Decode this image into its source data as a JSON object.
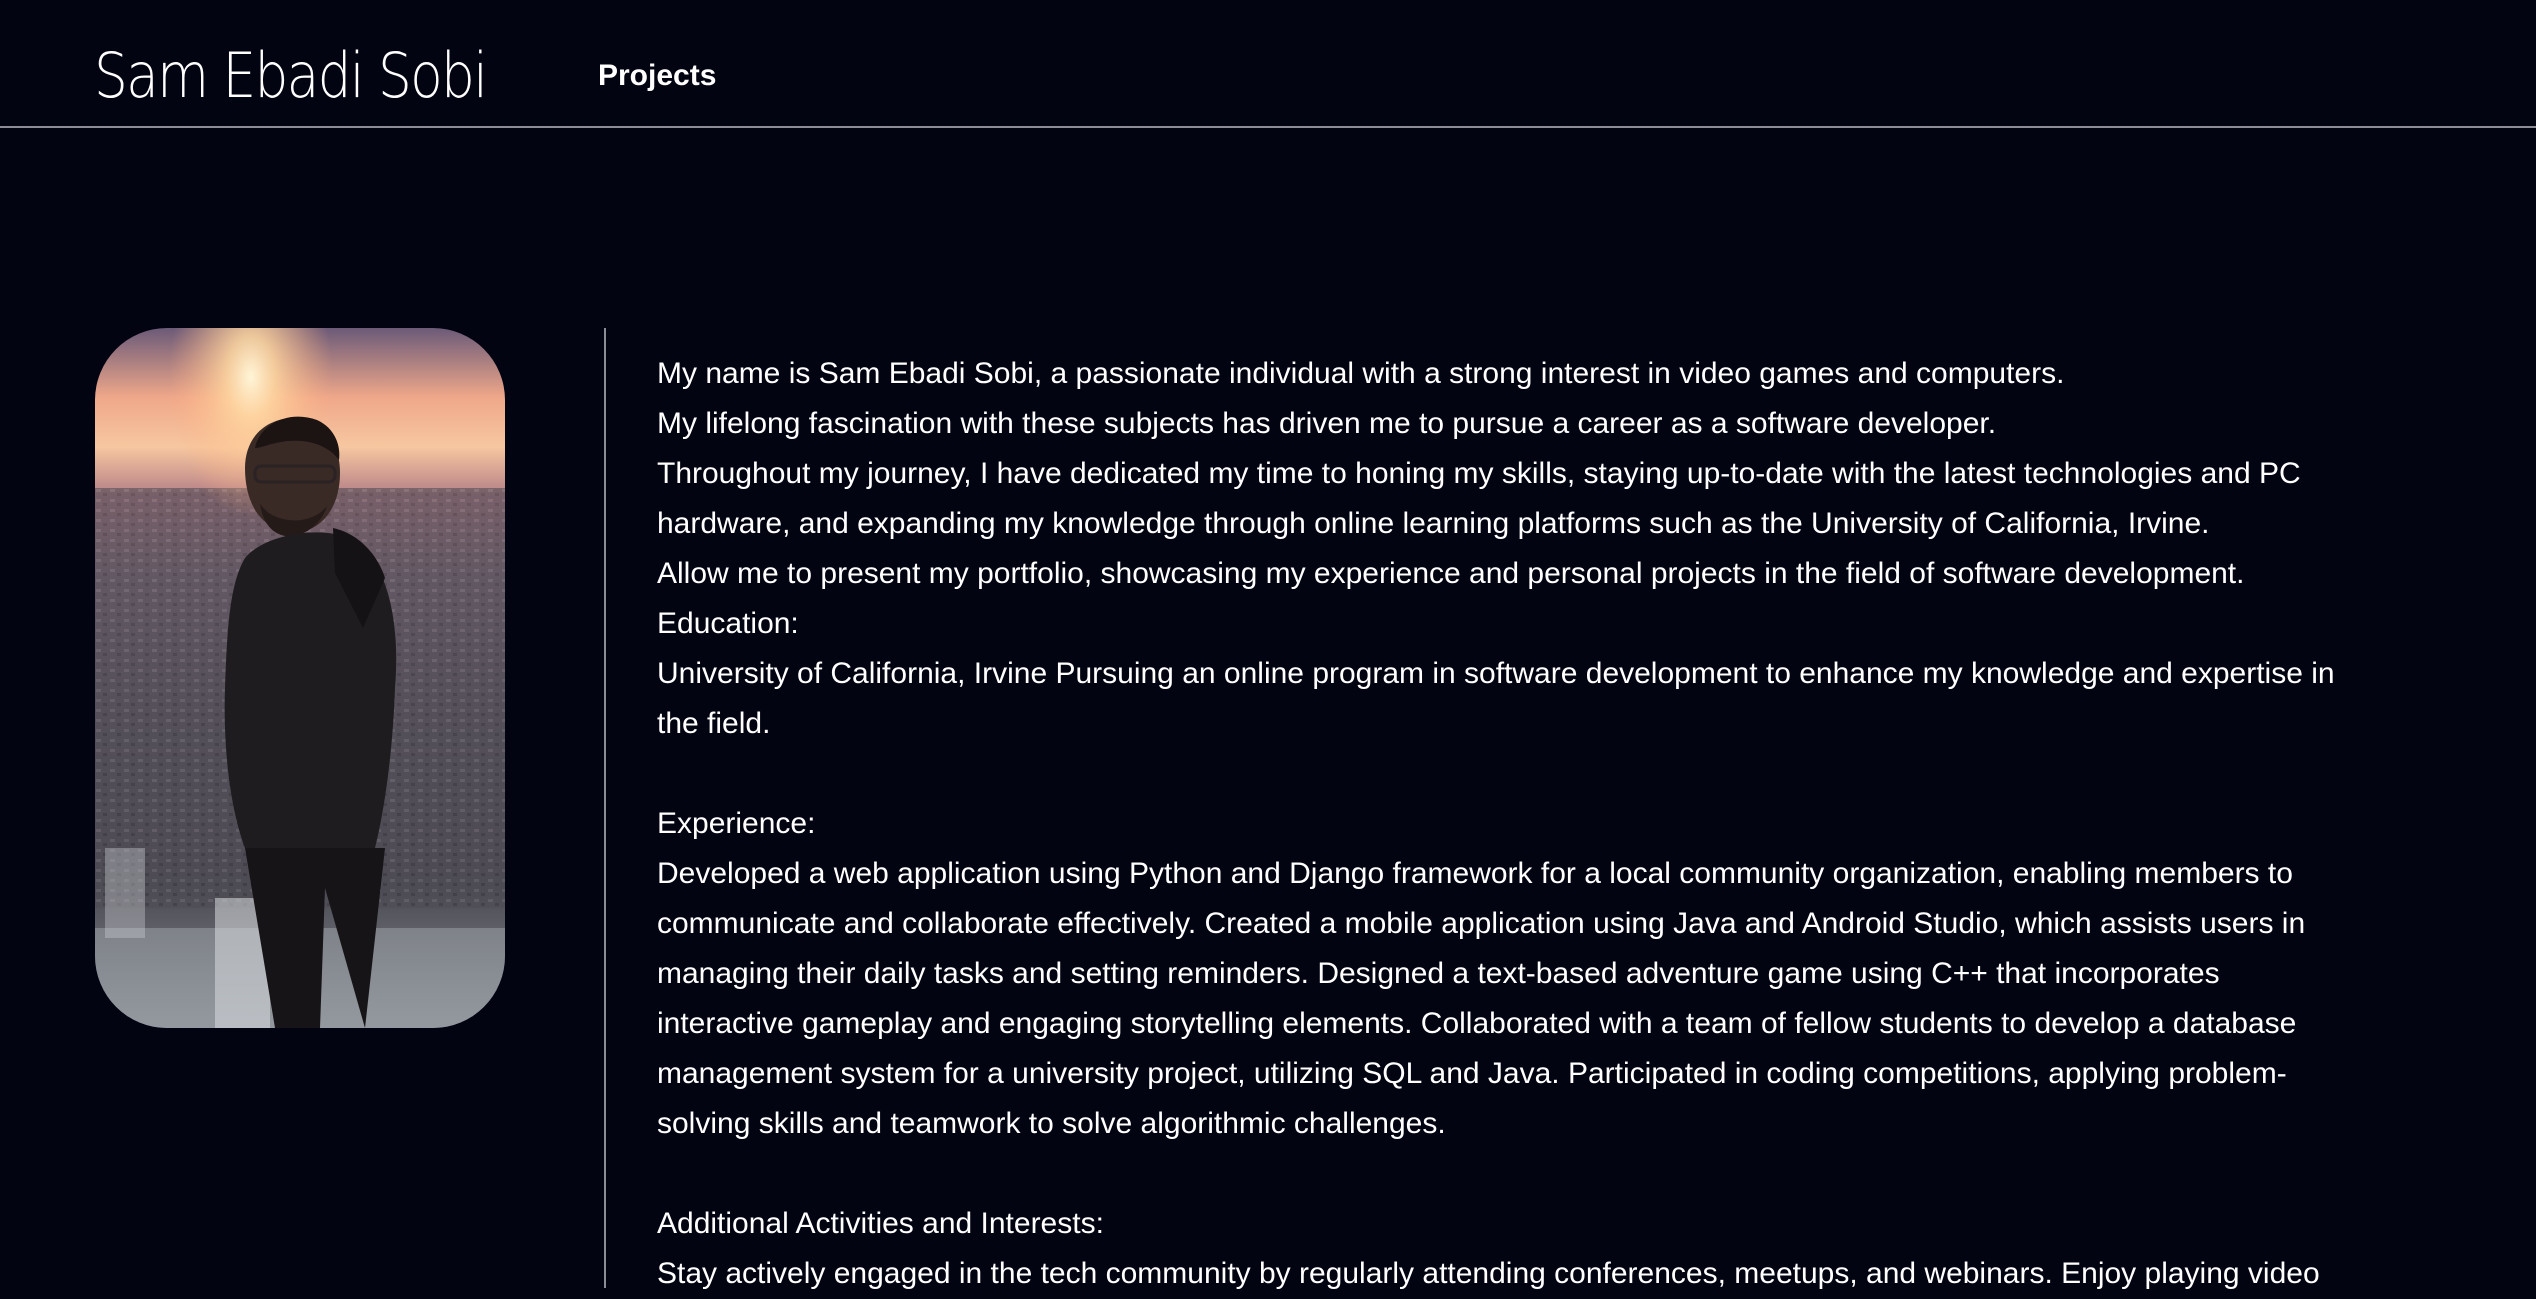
{
  "header": {
    "brand": "Sam Ebadi Sobi",
    "nav": [
      {
        "label": "Projects"
      }
    ]
  },
  "profile": {
    "photo_icon": "portrait-photo"
  },
  "about": {
    "intro": [
      "My name is Sam Ebadi Sobi, a passionate individual with a strong interest in video games and computers.",
      "My lifelong fascination with these subjects has driven me to pursue a career as a software developer.",
      "Throughout my journey, I have dedicated my time to honing my skills, staying up-to-date with the latest technologies and PC hardware, and expanding my knowledge through online learning platforms such as the University of California, Irvine.",
      "Allow me to present my portfolio, showcasing my experience and personal projects in the field of software development."
    ],
    "education_heading": "Education:",
    "education_text": "University of California, Irvine Pursuing an online program in software development to enhance my knowledge and expertise in the field.",
    "experience_heading": "Experience:",
    "experience_text": "Developed a web application using Python and Django framework for a local community organization, enabling members to communicate and collaborate effectively. Created a mobile application using Java and Android Studio, which assists users in managing their daily tasks and setting reminders. Designed a text-based adventure game using C++ that incorporates interactive gameplay and engaging storytelling elements. Collaborated with a team of fellow students to develop a database management system for a university project, utilizing SQL and Java. Participated in coding competitions, applying problem-solving skills and teamwork to solve algorithmic challenges.",
    "activities_heading": "Additional Activities and Interests:",
    "activities_text": "Stay actively engaged in the tech community by regularly attending conferences, meetups, and webinars. Enjoy playing video"
  }
}
